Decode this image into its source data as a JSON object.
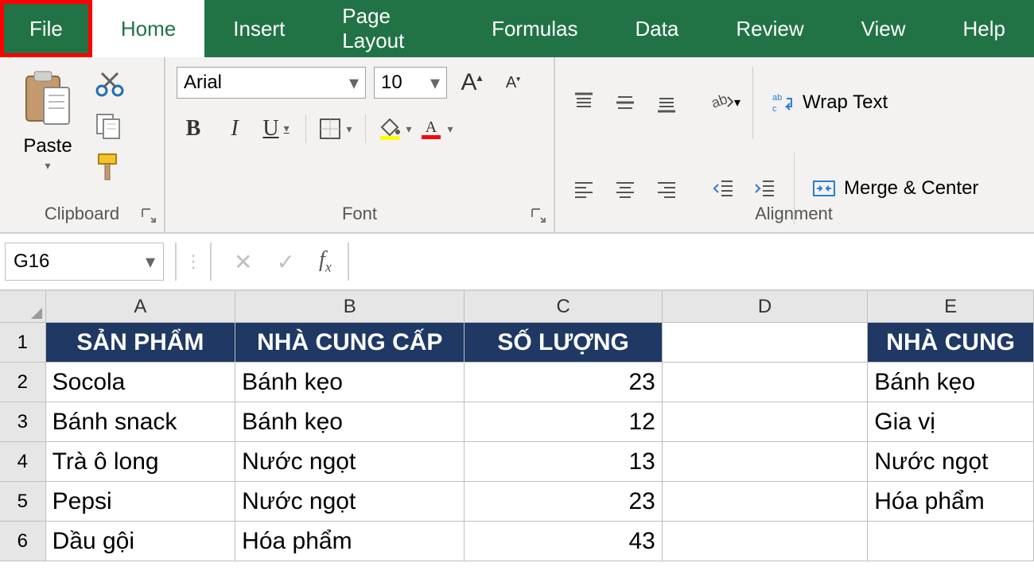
{
  "tabs": [
    "File",
    "Home",
    "Insert",
    "Page Layout",
    "Formulas",
    "Data",
    "Review",
    "View",
    "Help"
  ],
  "active_tab": "Home",
  "highlighted_tab": "File",
  "clipboard": {
    "label": "Clipboard",
    "paste": "Paste"
  },
  "font": {
    "label": "Font",
    "name": "Arial",
    "size": "10",
    "bold": "B",
    "italic": "I",
    "underline": "U"
  },
  "alignment": {
    "label": "Alignment",
    "wrap": "Wrap Text",
    "merge": "Merge & Center"
  },
  "name_box": "G16",
  "columns": [
    "A",
    "B",
    "C",
    "D",
    "E"
  ],
  "header_row": {
    "A": "SẢN PHẨM",
    "B": "NHÀ CUNG CẤP",
    "C": "SỐ LƯỢNG",
    "D": "",
    "E": "NHÀ CUNG"
  },
  "rows": [
    {
      "n": "2",
      "A": "Socola",
      "B": "Bánh kẹo",
      "C": "23",
      "D": "",
      "E": "Bánh kẹo"
    },
    {
      "n": "3",
      "A": "Bánh snack",
      "B": "Bánh kẹo",
      "C": "12",
      "D": "",
      "E": "Gia vị"
    },
    {
      "n": "4",
      "A": "Trà ô long",
      "B": "Nước ngọt",
      "C": "13",
      "D": "",
      "E": "Nước ngọt"
    },
    {
      "n": "5",
      "A": "Pepsi",
      "B": "Nước ngọt",
      "C": "23",
      "D": "",
      "E": "Hóa phẩm"
    },
    {
      "n": "6",
      "A": "Dầu gội",
      "B": "Hóa phẩm",
      "C": "43",
      "D": "",
      "E": ""
    }
  ]
}
